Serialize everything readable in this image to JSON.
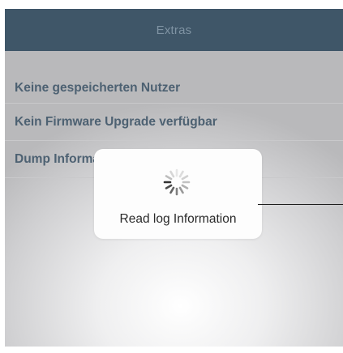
{
  "navbar": {
    "title": "Extras"
  },
  "list": {
    "items": [
      {
        "label": "Keine gespeicherten Nutzer"
      },
      {
        "label": "Kein Firmware Upgrade verfügbar"
      },
      {
        "label": "Dump Information"
      }
    ]
  },
  "hud": {
    "label": "Read log Information",
    "icon": "spinner-icon"
  },
  "colors": {
    "navbar": "#3f5668",
    "nav_title": "#7f93a3",
    "list_text": "#4d6172",
    "hud_bg": "#fdfdfd"
  }
}
